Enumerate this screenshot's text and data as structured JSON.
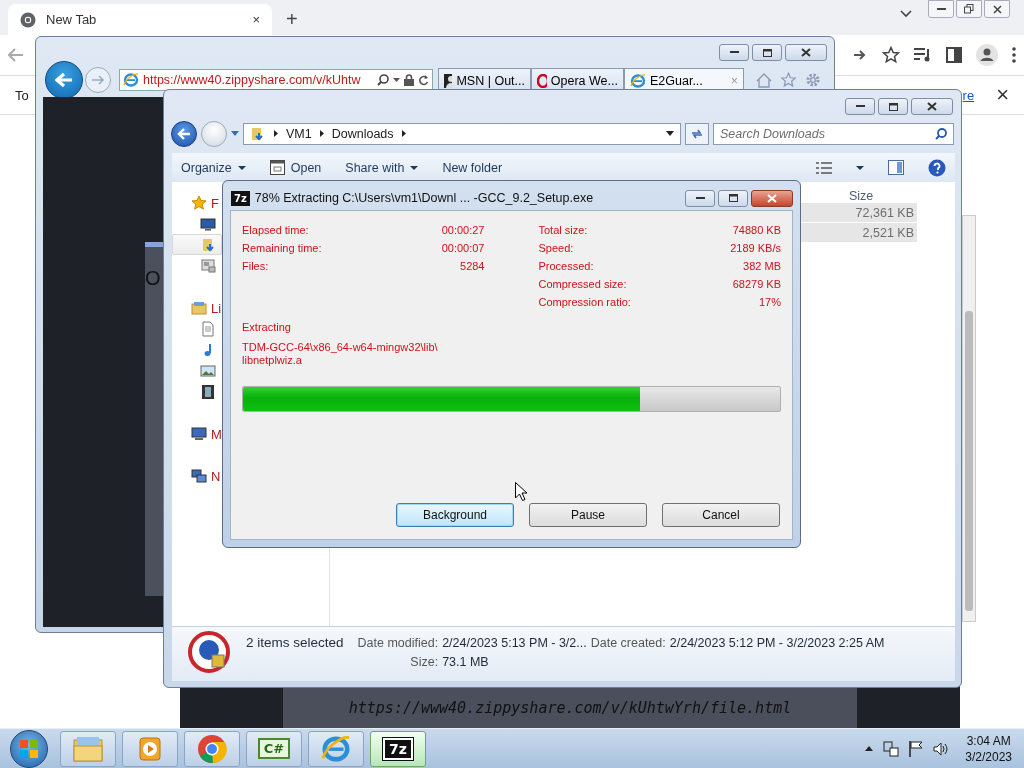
{
  "browser": {
    "tab": {
      "title": "New Tab",
      "close": "×"
    },
    "new_tab": "+",
    "infobar": {
      "text": "To",
      "link": "re",
      "close": "×"
    }
  },
  "ie": {
    "address": "https://www40.zippyshare.com/v/kUhtw",
    "tabs": [
      {
        "title": "MSN | Out...",
        "kind": "msn",
        "selected": false
      },
      {
        "title": "Opera We...",
        "kind": "opera",
        "selected": false
      },
      {
        "title": "E2Guar...",
        "kind": "ie",
        "selected": true,
        "close": "×"
      }
    ],
    "page_text": "O"
  },
  "page_strip": {
    "url": "https://www40.zippyshare.com/v/kUhtwYrh/file.html"
  },
  "explorer": {
    "breadcrumb": [
      "VM1",
      "Downloads"
    ],
    "search": {
      "placeholder": "Search Downloads"
    },
    "toolbar": [
      {
        "label": "Organize",
        "kind": "menu"
      },
      {
        "label": "Open",
        "kind": "open"
      },
      {
        "label": "Share with",
        "kind": "menu"
      },
      {
        "label": "New folder",
        "kind": "plain"
      }
    ],
    "sidebar": [
      {
        "label": "F",
        "kind": "star",
        "children": [
          {
            "kind": "desktop",
            "selected": false
          },
          {
            "kind": "downloads",
            "selected": true
          },
          {
            "kind": "recent",
            "selected": false
          }
        ]
      },
      {
        "label": "Li",
        "kind": "library",
        "children": [
          {
            "kind": "document",
            "selected": false
          },
          {
            "kind": "music",
            "selected": false
          },
          {
            "kind": "pictures",
            "selected": false
          },
          {
            "kind": "video",
            "selected": false
          }
        ]
      },
      {
        "label": "M",
        "kind": "computer"
      },
      {
        "label": "N",
        "kind": "network"
      }
    ],
    "columns": [
      "Size"
    ],
    "rows": [
      {
        "size": "72,361 KB",
        "selected": true
      },
      {
        "size": "2,521 KB",
        "selected": true
      }
    ],
    "details": {
      "summary": "2 items selected",
      "fields": [
        {
          "label": "Date modified:",
          "value": "2/24/2023 5:13 PM - 3/2..."
        },
        {
          "label": "Date created:",
          "value": "2/24/2023 5:12 PM - 3/2/2023 2:25 AM"
        },
        {
          "label": "Size:",
          "value": "73.1 MB"
        }
      ]
    }
  },
  "dialog": {
    "icon": "7z",
    "title": "78% Extracting C:\\Users\\vm1\\Downl ... -GCC_9.2_Setup.exe",
    "left_stats": [
      {
        "label": "Elapsed time:",
        "value": "00:00:27"
      },
      {
        "label": "Remaining time:",
        "value": "00:00:07"
      },
      {
        "label": "Files:",
        "value": "5284"
      }
    ],
    "right_stats": [
      {
        "label": "Total size:",
        "value": "74880 KB"
      },
      {
        "label": "Speed:",
        "value": "2189 KB/s"
      },
      {
        "label": "Processed:",
        "value": "382 MB"
      },
      {
        "label": "Compressed size:",
        "value": "68279 KB"
      },
      {
        "label": "Compression ratio:",
        "value": "17%"
      }
    ],
    "status": "Extracting",
    "current_file": "TDM-GCC-64\\x86_64-w64-mingw32\\lib\\libnetplwiz.a",
    "progress": {
      "level": 0.74
    },
    "buttons": [
      {
        "label": "Background",
        "default": true
      },
      {
        "label": "Pause",
        "default": false
      },
      {
        "label": "Cancel",
        "default": false
      }
    ]
  },
  "taskbar": {
    "apps": [
      {
        "kind": "explorer",
        "active": false
      },
      {
        "kind": "media",
        "active": false
      },
      {
        "kind": "chrome",
        "active": false
      },
      {
        "kind": "code",
        "label": "C#",
        "active": false
      },
      {
        "kind": "ie",
        "active": false
      },
      {
        "kind": "archive",
        "label": "7z",
        "active": true
      }
    ],
    "clock": {
      "time": "3:04 AM",
      "date": "3/2/2023"
    }
  }
}
